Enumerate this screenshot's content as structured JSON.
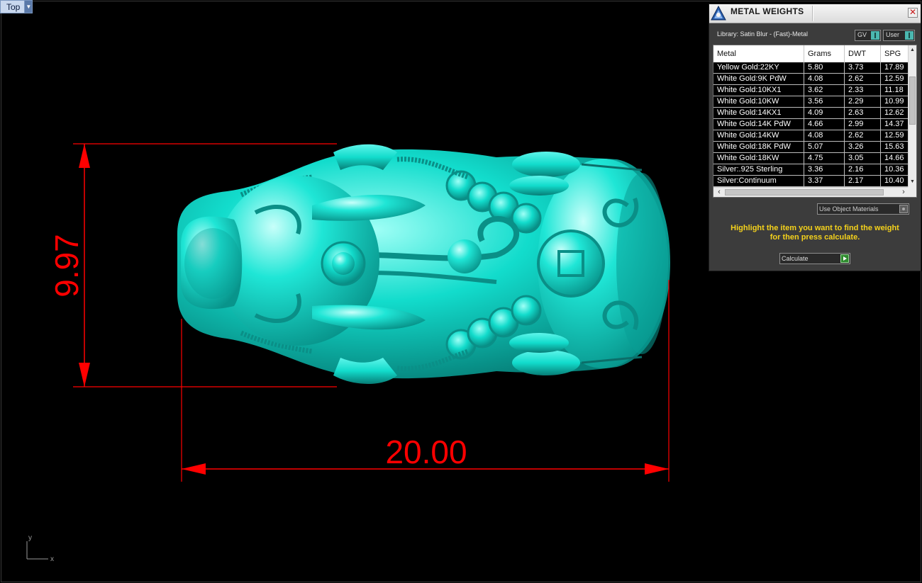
{
  "viewport": {
    "view_name": "Top",
    "dimension_height": "9.97",
    "dimension_width": "20.00",
    "axis_y": "y",
    "axis_x": "x"
  },
  "panel": {
    "title": "METAL WEIGHTS",
    "close_label": "✕",
    "library_label": "Library: Satin Blur - (Fast)-Metal",
    "gv_label": "GV",
    "user_label": "User",
    "columns": [
      "Metal",
      "Grams",
      "DWT",
      "SPG"
    ],
    "rows": [
      [
        "Yellow Gold:22KY",
        "5.80",
        "3.73",
        "17.89"
      ],
      [
        "White Gold:9K PdW",
        "4.08",
        "2.62",
        "12.59"
      ],
      [
        "White Gold:10KX1",
        "3.62",
        "2.33",
        "11.18"
      ],
      [
        "White Gold:10KW",
        "3.56",
        "2.29",
        "10.99"
      ],
      [
        "White Gold:14KX1",
        "4.09",
        "2.63",
        "12.62"
      ],
      [
        "White Gold:14K PdW",
        "4.66",
        "2.99",
        "14.37"
      ],
      [
        "White Gold:14KW",
        "4.08",
        "2.62",
        "12.59"
      ],
      [
        "White Gold:18K PdW",
        "5.07",
        "3.26",
        "15.63"
      ],
      [
        "White Gold:18KW",
        "4.75",
        "3.05",
        "14.66"
      ],
      [
        "Silver:.925 Sterling",
        "3.36",
        "2.16",
        "10.36"
      ],
      [
        "Silver:Continuum",
        "3.37",
        "2.17",
        "10.40"
      ]
    ],
    "use_object_materials_label": "Use Object Materials",
    "hint_line1": "Highlight the item you want to find the weight",
    "hint_line2": "for then press calculate.",
    "calculate_label": "Calculate"
  },
  "colors": {
    "model": "#12dccc",
    "dimension": "#ff0000",
    "hint": "#f5d21b",
    "panel_bg": "#3c3c3c"
  }
}
